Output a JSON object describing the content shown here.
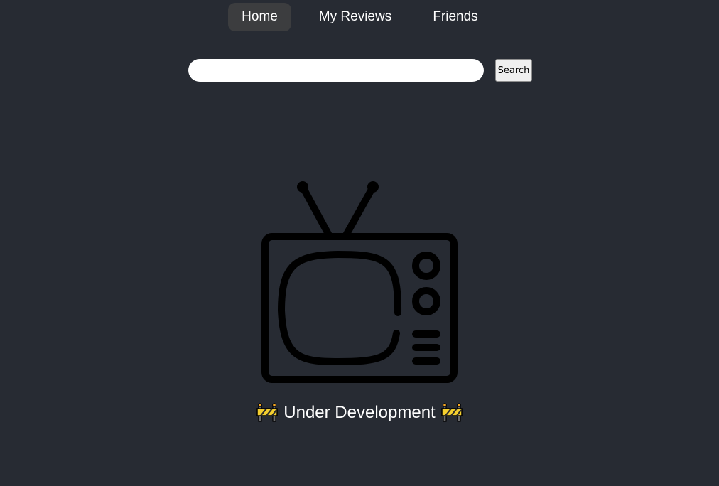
{
  "nav": {
    "items": [
      {
        "label": "Home",
        "active": true
      },
      {
        "label": "My Reviews",
        "active": false
      },
      {
        "label": "Friends",
        "active": false
      }
    ]
  },
  "search": {
    "value": "",
    "placeholder": "",
    "button_label": "Search"
  },
  "illustration": {
    "icon": "television-icon"
  },
  "status": {
    "text": "Under Development",
    "left_icon": "construction-barrier-icon",
    "right_icon": "construction-barrier-icon"
  },
  "colors": {
    "background": "#272b33",
    "nav_active_bg": "#3c3d3f",
    "text": "#ffffff",
    "icon_stroke": "#000000"
  }
}
